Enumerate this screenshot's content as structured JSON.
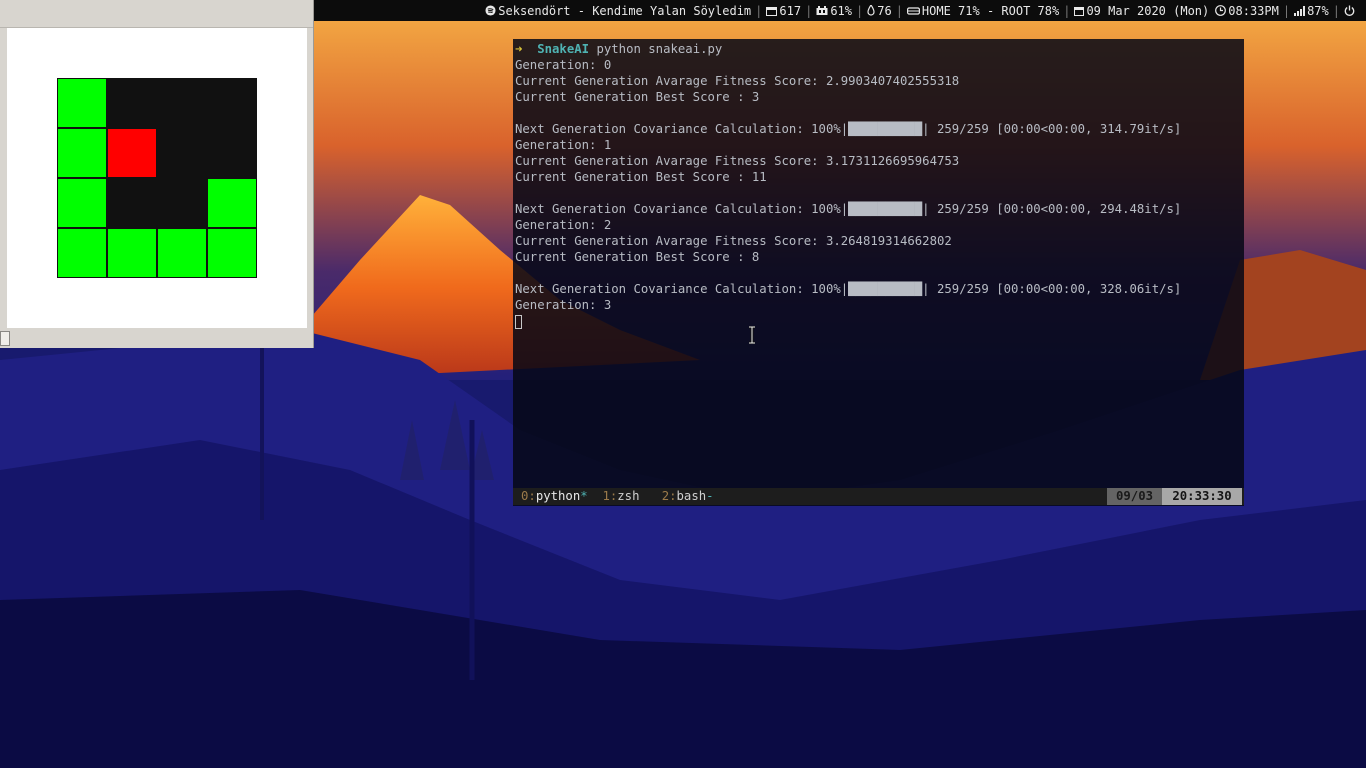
{
  "statusbar": {
    "music": "Seksendört - Kendime Yalan Söyledim",
    "packages": "617",
    "memory": "61%",
    "temperature": "76",
    "disk": "HOME 71% - ROOT 78%",
    "date": "09 Mar 2020 (Mon)",
    "time": "08:33PM",
    "wifi": "87%",
    "icons": [
      "spotify-icon",
      "package-icon",
      "memory-icon",
      "temperature-icon",
      "disk-icon",
      "calendar-icon",
      "clock-icon",
      "wifi-icon",
      "power-icon"
    ]
  },
  "snake": {
    "grid": [
      [
        "green",
        "empty",
        "empty",
        "empty"
      ],
      [
        "green",
        "red",
        "empty",
        "empty"
      ],
      [
        "green",
        "empty",
        "empty",
        "green"
      ],
      [
        "green",
        "green",
        "green",
        "green"
      ]
    ],
    "colors": {
      "snake": "#00ff00",
      "food": "#ff0000",
      "board": "#111111"
    }
  },
  "terminal": {
    "prompt": {
      "arrow": "➜",
      "dir": "SnakeAI",
      "command": "python snakeai.py"
    },
    "lines": [
      "Generation: 0",
      "Current Generation Avarage Fitness Score: 2.9903407402555318",
      "Current Generation Best Score : 3",
      "",
      "Next Generation Covariance Calculation: 100%|██████████| 259/259 [00:00<00:00, 314.79it/s]",
      "Generation: 1",
      "Current Generation Avarage Fitness Score: 3.1731126695964753",
      "Current Generation Best Score : 11",
      "",
      "Next Generation Covariance Calculation: 100%|██████████| 259/259 [00:00<00:00, 294.48it/s]",
      "Generation: 2",
      "Current Generation Avarage Fitness Score: 3.264819314662802",
      "Current Generation Best Score : 8",
      "",
      "Next Generation Covariance Calculation: 100%|██████████| 259/259 [00:00<00:00, 328.06it/s]",
      "Generation: 3"
    ]
  },
  "tmux": {
    "windows": [
      {
        "index": "0",
        "name": "python",
        "flag": "*"
      },
      {
        "index": "1",
        "name": "zsh",
        "flag": ""
      },
      {
        "index": "2",
        "name": "bash",
        "flag": "-"
      }
    ],
    "date": "09/03",
    "time": "20:33:30"
  }
}
